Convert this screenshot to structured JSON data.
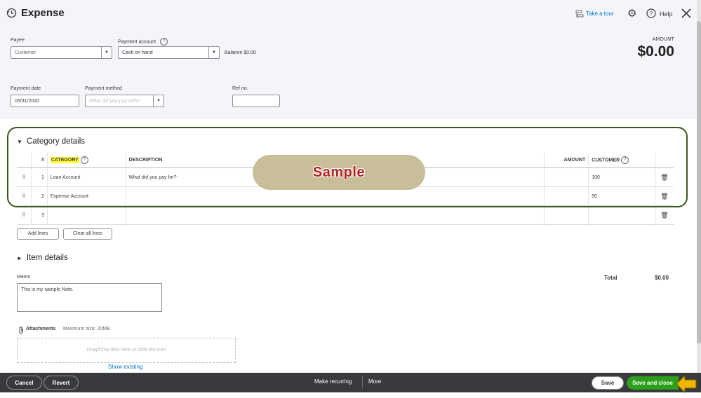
{
  "header": {
    "title": "Expense",
    "take_tour": "Take a tour",
    "help": "Help"
  },
  "payee": {
    "label": "Payee",
    "placeholder": "Customer"
  },
  "payment_account": {
    "label": "Payment account",
    "value": "Cash on hand",
    "balance_label": "Balance",
    "balance_value": "$0.00"
  },
  "amount": {
    "label": "AMOUNT",
    "value": "$0.00"
  },
  "payment_date": {
    "label": "Payment date",
    "value": "05/31/2020"
  },
  "payment_method": {
    "label": "Payment method",
    "placeholder": "What did you pay with?"
  },
  "ref_no": {
    "label": "Ref no.",
    "value": ""
  },
  "category_details": {
    "title": "Category details",
    "columns": {
      "num": "#",
      "category": "CATEGORY",
      "description": "DESCRIPTION",
      "amount": "AMOUNT",
      "customer": "CUSTOMER"
    },
    "rows": [
      {
        "num": "1",
        "category": "Loan Account",
        "description": "What did you pay for?",
        "amount": "",
        "customer": "100"
      },
      {
        "num": "2",
        "category": "Expense Account",
        "description": "",
        "amount": "",
        "customer": "50"
      },
      {
        "num": "3",
        "category": "",
        "description": "",
        "amount": "",
        "customer": ""
      }
    ],
    "add_lines": "Add lines",
    "clear_all_lines": "Clear all lines"
  },
  "watermark": "Sample",
  "item_details": {
    "title": "Item details"
  },
  "memo": {
    "label": "Memo",
    "value": "This is my sample Note."
  },
  "total": {
    "label": "Total",
    "value": "$0.00"
  },
  "attachments": {
    "label": "Attachments",
    "max_size": "Maximum size: 20MB",
    "drop_text": "Drag/Drop files here or click the icon",
    "show_existing": "Show existing"
  },
  "footer": {
    "cancel": "Cancel",
    "revert": "Revert",
    "make_recurring": "Make recurring",
    "more": "More",
    "save": "Save",
    "save_and_close": "Save and close"
  },
  "colors": {
    "accent_green": "#2ca01c",
    "link_blue": "#0077c5",
    "footer_bg": "#393a3d",
    "highlight": "#ffff33",
    "callout_border": "#3a5a1c",
    "arrow": "#f0b400"
  }
}
